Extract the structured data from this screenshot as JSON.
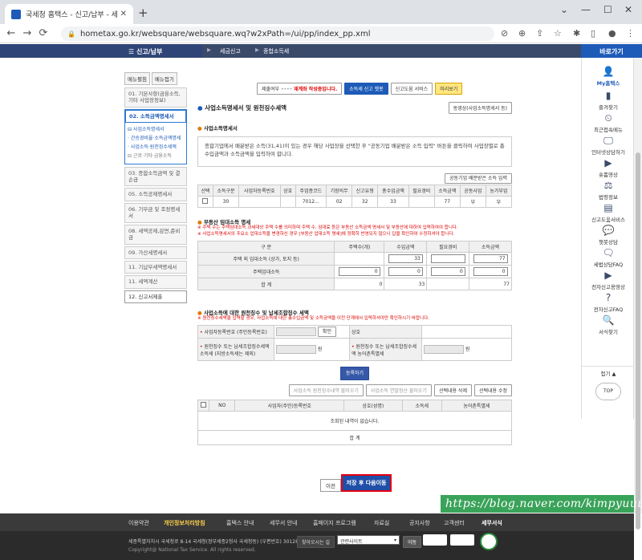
{
  "browser": {
    "tab_title": "국세청 홈택스 - 신고/납부 - 세",
    "url": "hometax.go.kr/websquare/websquare.wq?w2xPath=/ui/pp/index_pp.xml"
  },
  "topnav": {
    "menu": "☰ 신고/납부",
    "crumbs": [
      "세금신고",
      "종합소득세"
    ],
    "quick_title": "바로가기"
  },
  "quick": [
    "My홈택스",
    "즐겨찾기",
    "최근접속메뉴",
    "인터넷상담하기",
    "숏폼영상",
    "법령정보",
    "신고도움서비스",
    "챗봇상담",
    "세법상담FAQ",
    "전자신고용영상",
    "전자신고FAQ",
    "서식찾기",
    "접기 ▲",
    "TOP"
  ],
  "side": {
    "tabs": [
      "메뉴펼침",
      "메뉴접기"
    ],
    "steps": [
      "01. 기본사항(금융소득, 기타 사업장정보)",
      "02. 소득금액명세서",
      "03. 종합소득금액 및 결손금",
      "05. 소득공제명세서",
      "06. 기부금 및 조정명세서",
      "08. 세액공제,감면,준비금",
      "09. 가산세명세서",
      "11. 기납부세액명세서",
      "11. 세액계산",
      "12. 신고서제출"
    ],
    "subs": [
      "⊟ 사업소득명세서",
      "· 간승경비율·소득금액명세",
      "· 사업소득·원천징수세액",
      "⊟ 근로·기타·금융소득"
    ]
  },
  "topbtns": {
    "status_label": "제출여부",
    "status_dots": "••••",
    "status_value": "재계좌 작성중입니다.",
    "submit": "소득세 신고 챗봇",
    "help": "신고도움 서비스",
    "preview": "미리보기"
  },
  "main": {
    "title": "사업소득명세서 및 원천징수세액",
    "title_btn": "동영상(사업소득명세서 등)",
    "sub1": "사업소득명세서",
    "note": "종합기업에서 배분받은 소득(31,41)이 있는 경우 해당 사업장을 선택한 후 \"공동기업 배분받은 소득 입력\" 버튼을 클릭하여 사업장별로 총수입금액과 소득금액을 입력하여 합니다.",
    "partner_btn": "공동기업 배분받은 소득 입력",
    "t1_headers": [
      "선택",
      "소득구분",
      "사업자등록번호",
      "상호",
      "주업종코드",
      "기장의무",
      "신고유형",
      "총수입금액",
      "필요경비",
      "소득금액",
      "공동사업",
      "농가부업"
    ],
    "t1_row": [
      "",
      "30",
      "",
      "",
      "7012...",
      "02",
      "32",
      "33",
      "",
      "77",
      "부",
      "부"
    ],
    "sub2": "부동산 임대소득 명세",
    "sub2_note1": "※ 주택 수는 주택임대소득 과세대상 주택 수를 의미하며 주택 수, 임대료 등은 부동산 소득금액 명세서 및 부동산에 대하여 입력하여야 합니다.",
    "sub2_note2": "※ 사업소득명세서의 주요소 업대소득을 변경하신 경우 [부동산 업대소득 명세]에 정확히 반영되지 않으니 답을 확인하여 수정하셔야 합니다.",
    "t2_headers": [
      "구 분",
      "주택수(개)",
      "수입금액",
      "필요경비",
      "소득금액"
    ],
    "t2_rows": [
      {
        "label": "주택 외 임대소득 (상가, 토지 등)",
        "count": "",
        "rev": "33",
        "exp": "",
        "inc": "77"
      },
      {
        "label": "주택임대소득",
        "count": "0",
        "rev": "0",
        "exp": "0",
        "inc": "0"
      },
      {
        "label": "합 계",
        "count": "0",
        "rev": "33",
        "exp": "",
        "inc": "77"
      }
    ],
    "sub3": "사업소득에 대한 원천징수 및 납세조합징수 세액",
    "sub3_note": "※ 원천징수세액을 입력할 경우, 사업소득에 대한 총수입금액 및 소득금액을 이전 단계에서 입력하셔야만 확인하시기 바랍니다.",
    "f_bizno": "사업자등록번호 (주민등록번호)",
    "f_check": "확인",
    "f_name": "상호",
    "f_withhold": "원천징수 또는 납세조합징수세액 소득세 (지방소득세는 제외)",
    "f_local": "원천징수 또는 납세조합징수세액 농어촌특별세",
    "won": "원",
    "register": "등록하기",
    "t3_btns": [
      "사업소득 원천징수내역 불러오기",
      "사업소득 연말정산 불러오기",
      "선택내용 삭제",
      "선택내용 수정"
    ],
    "t3_headers": [
      "",
      "NO",
      "사업자(주민)등록번호",
      "상호(성명)",
      "소득세",
      "농어촌특별세"
    ],
    "t3_empty": "조회된 내역이 없습니다.",
    "t3_sum": "합 계",
    "prev": "이전",
    "next": "저장 후 다음이동"
  },
  "watermark": "https://blog.naver.com/kimpyuuuu",
  "footer": {
    "links": [
      "이용약관",
      "개인정보처리방침",
      "홈택스 안내",
      "세무서 안내",
      "홈페이지 프로그램",
      "자료실",
      "공지사항",
      "고객센터",
      "세무서식"
    ],
    "address": "세종특별자치시 국세청로 8-14 국세청(정부세종2청사 국세청동) (우편번호) 30128",
    "copyright": "Copyright@ National Tax Service. All rights reserved.",
    "find": "찾아오시는 길",
    "related": "관련사이트",
    "move": "이동"
  }
}
